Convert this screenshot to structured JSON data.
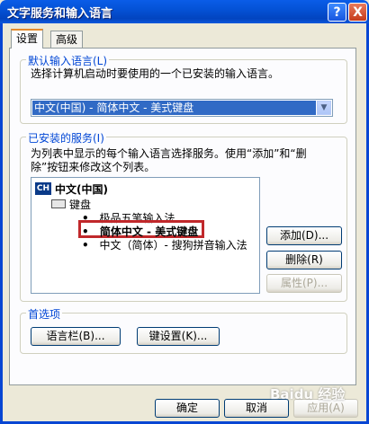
{
  "window": {
    "title": "文字服务和输入语言",
    "help_button": "?",
    "close_button": "X"
  },
  "tabs": [
    {
      "label": "设置"
    },
    {
      "label": "高级"
    }
  ],
  "default_language": {
    "legend": "默认输入语言(L)",
    "description": "选择计算机启动时要使用的一个已安装的输入语言。",
    "selected_value": "中文(中国) - 简体中文 - 美式键盘"
  },
  "installed_services": {
    "legend": "已安装的服务(I)",
    "description_line1": "为列表中显示的每个输入语言选择服务。使用“添加”和“删",
    "description_line2": "除”按钮来修改这个列表。",
    "tree": {
      "language_badge": "CH",
      "language": "中文(中国)",
      "category": "键盘",
      "items": [
        {
          "bullet": "•",
          "label": "极品五笔输入法"
        },
        {
          "bullet": "•",
          "label": "简体中文 - 美式键盘"
        },
        {
          "bullet": "•",
          "label": "中文（简体）- 搜狗拼音输入法"
        }
      ]
    },
    "buttons": {
      "add": "添加(D)...",
      "remove": "删除(R)",
      "properties": "属性(P)..."
    }
  },
  "preferences": {
    "legend": "首选项",
    "language_bar_button": "语言栏(B)...",
    "key_settings_button": "键设置(K)..."
  },
  "footer": {
    "ok": "确定",
    "cancel": "取消",
    "apply": "应用(A)"
  },
  "watermark": "Baidu 经验"
}
